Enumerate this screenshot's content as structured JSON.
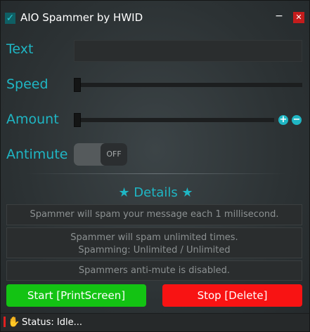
{
  "window": {
    "title": "AIO Spammer by HWID",
    "minimize_label": "−",
    "close_label": "✕",
    "app_icon": "✓"
  },
  "form": {
    "text": {
      "label": "Text",
      "value": ""
    },
    "speed": {
      "label": "Speed",
      "value": 0
    },
    "amount": {
      "label": "Amount",
      "value": 0,
      "plus_label": "+",
      "minus_label": "−"
    },
    "antimute": {
      "label": "Antimute",
      "state": "OFF"
    }
  },
  "details": {
    "title": "★ Details ★",
    "line1": "Spammer will spam your message each 1 millisecond.",
    "line2a": "Spammer will spam unlimited times.",
    "line2b": "Spamming: Unlimited / Unlimited",
    "line3": "Spammers anti-mute is disabled."
  },
  "buttons": {
    "start": "Start [PrintScreen]",
    "stop": "Stop [Delete]"
  },
  "status": {
    "text": "Status: Idle..."
  },
  "colors": {
    "accent": "#1fb6c4",
    "start": "#13c313",
    "stop": "#f81313",
    "close": "#c41c1c"
  },
  "icons": {
    "app": "check-icon",
    "status": "hand-icon"
  }
}
